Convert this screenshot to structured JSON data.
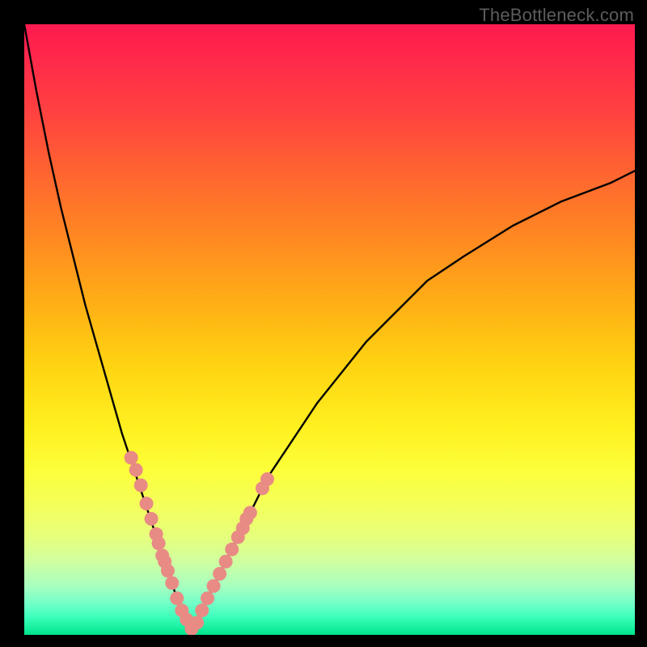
{
  "watermark": "TheBottleneck.com",
  "colors": {
    "background": "#000000",
    "curve_stroke": "#000000",
    "marker_fill": "#e88b85",
    "gradient_top": "#ff1a4f",
    "gradient_bottom": "#00e08a"
  },
  "chart_data": {
    "type": "line",
    "title": "",
    "xlabel": "",
    "ylabel": "",
    "xlim": [
      0,
      100
    ],
    "ylim": [
      0,
      100
    ],
    "grid": false,
    "legend": false,
    "series": [
      {
        "name": "left-branch",
        "x": [
          0,
          2,
          4,
          6,
          8,
          10,
          12,
          14,
          16,
          18,
          20,
          21,
          22,
          23,
          24,
          25,
          26,
          27
        ],
        "y": [
          100,
          89,
          79,
          70,
          62,
          54,
          47,
          40,
          33,
          27,
          21,
          18,
          15,
          12,
          9,
          6,
          3,
          0
        ]
      },
      {
        "name": "right-branch",
        "x": [
          27,
          28,
          29,
          30,
          32,
          34,
          36,
          38,
          40,
          44,
          48,
          52,
          56,
          60,
          66,
          72,
          80,
          88,
          96,
          100
        ],
        "y": [
          0,
          2,
          4,
          6,
          10,
          14,
          18,
          22,
          26,
          32,
          38,
          43,
          48,
          52,
          58,
          62,
          67,
          71,
          74,
          76
        ]
      }
    ],
    "scatter_points": {
      "name": "highlighted-points",
      "x": [
        17.5,
        18.3,
        19.1,
        20.0,
        20.8,
        21.6,
        22.0,
        22.6,
        23.0,
        23.5,
        24.2,
        25.0,
        25.8,
        26.6,
        27.4,
        28.3,
        29.1,
        30.0,
        31.0,
        32.0,
        33.0,
        34.0,
        35.0,
        35.8,
        36.4,
        37.0,
        39.0,
        39.8
      ],
      "y": [
        29.0,
        27.0,
        24.5,
        21.5,
        19.0,
        16.5,
        15.0,
        13.0,
        12.0,
        10.5,
        8.5,
        6.0,
        4.0,
        2.5,
        1.0,
        2.0,
        4.0,
        6.0,
        8.0,
        10.0,
        12.0,
        14.0,
        16.0,
        17.5,
        19.0,
        20.0,
        24.0,
        25.5
      ]
    }
  }
}
